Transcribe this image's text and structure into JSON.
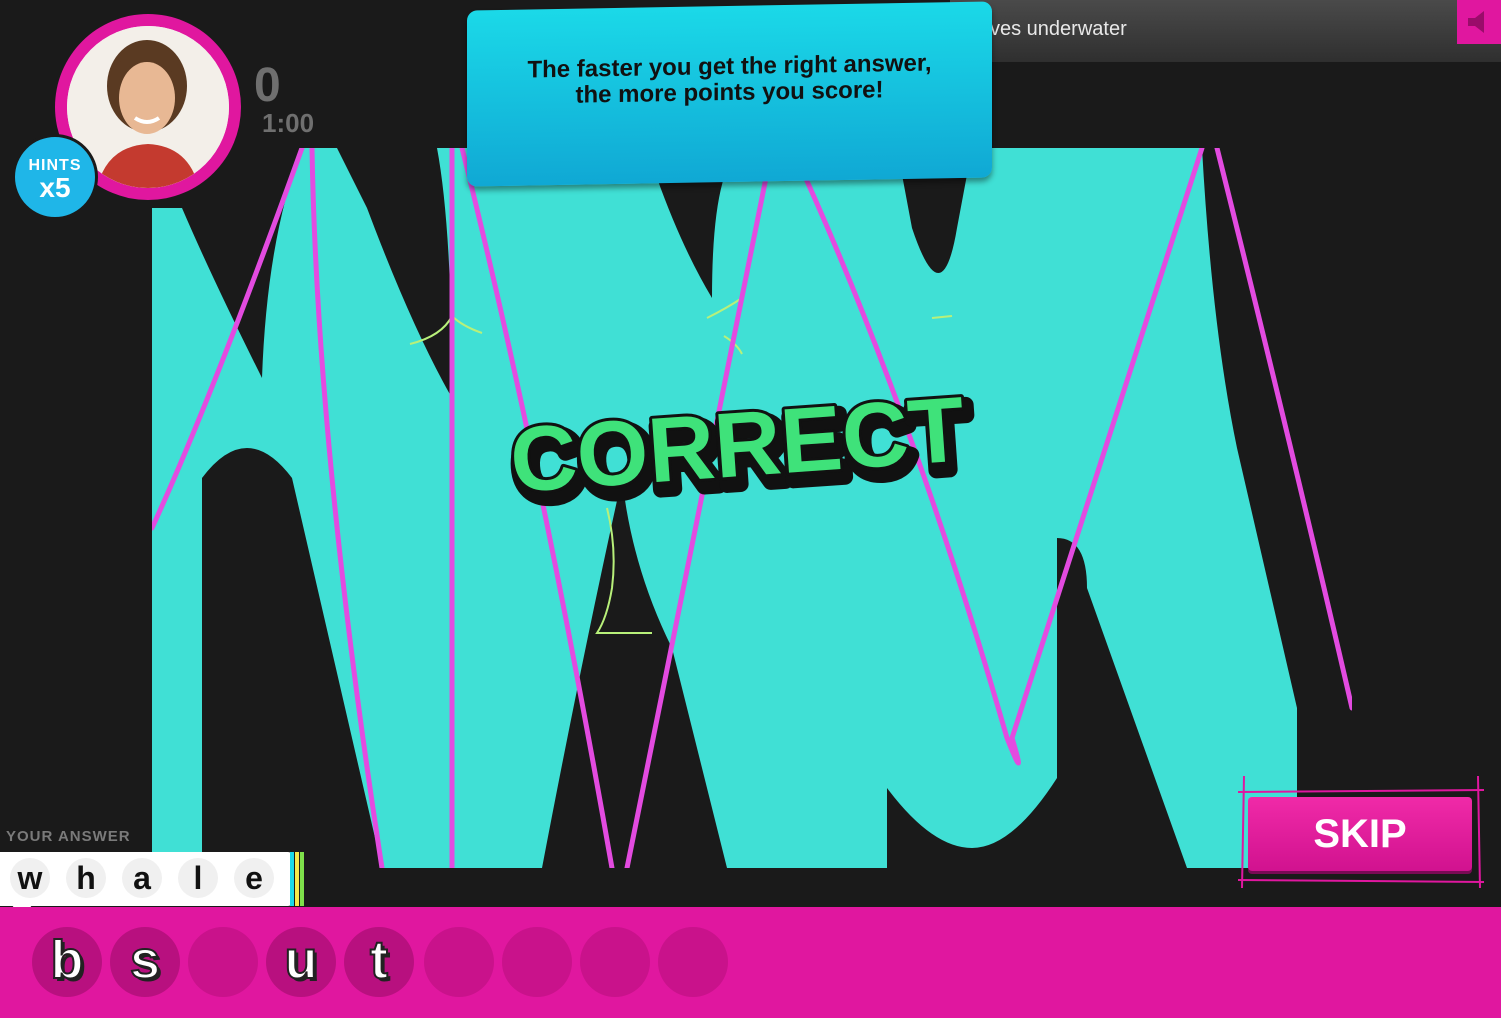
{
  "header": {
    "prompt_text": "ves underwater",
    "sound_icon": "speaker-icon"
  },
  "player": {
    "hints_label": "HINTS",
    "hints_count": "x5",
    "score": "0",
    "timer": "1:00"
  },
  "tooltip": {
    "line1": "The faster you get the right answer,",
    "line2": "the more points you score!"
  },
  "feedback": {
    "text": "CORRECT",
    "color": "#3fe27a"
  },
  "skip_label": "SKIP",
  "answer": {
    "label": "YOUR ANSWER",
    "letters": [
      "w",
      "h",
      "a",
      "l",
      "e"
    ]
  },
  "letter_tiles": [
    "b",
    "s",
    "",
    "u",
    "t",
    "",
    "",
    "",
    ""
  ],
  "colors": {
    "accent_pink": "#e0179f",
    "aqua": "#40e0d5",
    "line_pink": "#e34be0",
    "sketch_green": "#b8f07a"
  }
}
